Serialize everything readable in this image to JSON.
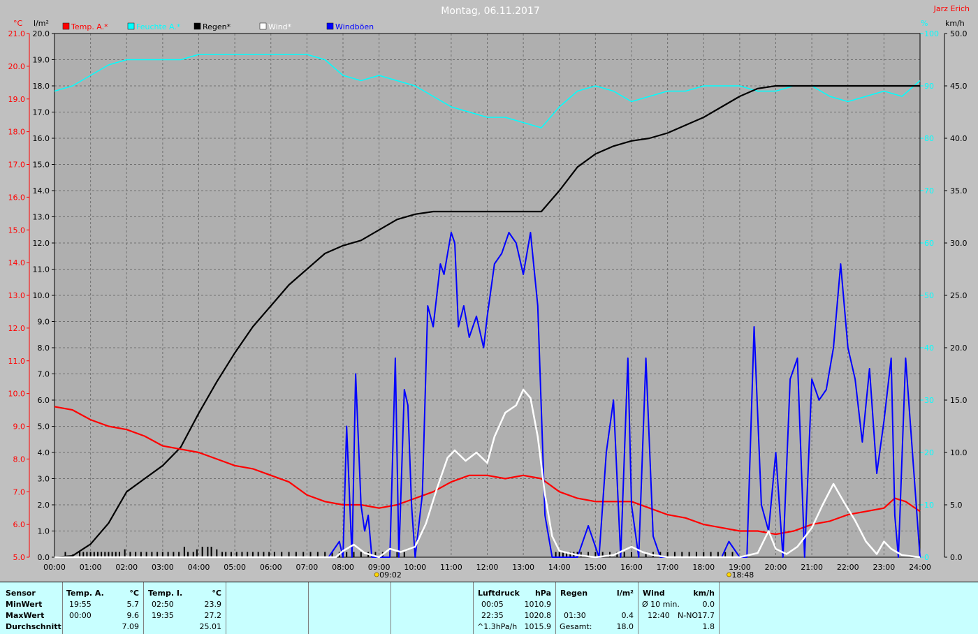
{
  "header": {
    "title": "Montag, 06.11.2017",
    "author": "Jarz Erich",
    "unit_temp": "°C",
    "unit_rain": "l/m²",
    "unit_hum": "%",
    "unit_wind": "km/h"
  },
  "legend": [
    {
      "label": "Temp. A.*",
      "color": "#ff0000"
    },
    {
      "label": "Feuchte A.*",
      "color": "#00ffff"
    },
    {
      "label": "Regen*",
      "color": "#000000"
    },
    {
      "label": "Wind*",
      "color": "#ffffff"
    },
    {
      "label": "Windböen",
      "color": "#0000ff"
    }
  ],
  "markers": [
    {
      "label": "09:02",
      "hour": 9.03
    },
    {
      "label": "18:48",
      "hour": 18.8
    }
  ],
  "chart_data": {
    "type": "line",
    "x_unit": "hour",
    "xlim": [
      0,
      24
    ],
    "x_tick_labels": [
      "00:00",
      "01:00",
      "02:00",
      "03:00",
      "04:00",
      "05:00",
      "06:00",
      "07:00",
      "08:00",
      "09:00",
      "10:00",
      "11:00",
      "12:00",
      "13:00",
      "14:00",
      "15:00",
      "16:00",
      "17:00",
      "18:00",
      "19:00",
      "20:00",
      "21:00",
      "22:00",
      "23:00",
      "24:00"
    ],
    "axes": {
      "temp": {
        "lim": [
          5,
          21
        ],
        "ticks": [
          "5.0",
          "6.0",
          "7.0",
          "8.0",
          "9.0",
          "10.0",
          "11.0",
          "12.0",
          "13.0",
          "14.0",
          "15.0",
          "16.0",
          "17.0",
          "18.0",
          "19.0",
          "20.0",
          "21.0"
        ],
        "color": "#ff0000"
      },
      "rain": {
        "lim": [
          0,
          20
        ],
        "ticks": [
          "0.0",
          "1.0",
          "2.0",
          "3.0",
          "4.0",
          "5.0",
          "6.0",
          "7.0",
          "8.0",
          "9.0",
          "10.0",
          "11.0",
          "12.0",
          "13.0",
          "14.0",
          "15.0",
          "16.0",
          "17.0",
          "18.0",
          "19.0",
          "20.0"
        ],
        "color": "#000000"
      },
      "hum": {
        "lim": [
          0,
          100
        ],
        "ticks": [
          "0",
          "10",
          "20",
          "30",
          "40",
          "50",
          "60",
          "70",
          "80",
          "90",
          "100"
        ],
        "color": "#00ffff"
      },
      "wind": {
        "lim": [
          0,
          50
        ],
        "ticks": [
          "0.0",
          "5.0",
          "10.0",
          "15.0",
          "20.0",
          "25.0",
          "30.0",
          "35.0",
          "40.0",
          "45.0",
          "50.0"
        ],
        "color": "#000000"
      }
    },
    "series": [
      {
        "name": "Temp. A.*",
        "axis": "temp",
        "color": "#ff0000",
        "width": 2.2,
        "x": [
          0,
          0.5,
          1,
          1.5,
          2,
          2.5,
          3,
          3.5,
          4,
          4.5,
          5,
          5.5,
          6,
          6.5,
          7,
          7.5,
          8,
          8.5,
          9,
          9.5,
          10,
          10.5,
          11,
          11.5,
          12,
          12.5,
          13,
          13.5,
          14,
          14.5,
          15,
          15.5,
          16,
          16.5,
          17,
          17.5,
          18,
          18.5,
          19,
          19.5,
          20,
          20.5,
          21,
          21.5,
          22,
          22.5,
          23,
          23.3,
          23.6,
          24
        ],
        "y": [
          9.6,
          9.5,
          9.2,
          9.0,
          8.9,
          8.7,
          8.4,
          8.3,
          8.2,
          8.0,
          7.8,
          7.7,
          7.5,
          7.3,
          6.9,
          6.7,
          6.6,
          6.6,
          6.5,
          6.6,
          6.8,
          7.0,
          7.3,
          7.5,
          7.5,
          7.4,
          7.5,
          7.4,
          7.0,
          6.8,
          6.7,
          6.7,
          6.7,
          6.5,
          6.3,
          6.2,
          6.0,
          5.9,
          5.8,
          5.8,
          5.7,
          5.8,
          6.0,
          6.1,
          6.3,
          6.4,
          6.5,
          6.8,
          6.7,
          6.4
        ]
      },
      {
        "name": "Feuchte A.*",
        "axis": "hum",
        "color": "#00ffff",
        "width": 1.5,
        "x": [
          0,
          0.5,
          1,
          1.5,
          2,
          2.5,
          3,
          3.5,
          4,
          5,
          6,
          7,
          7.5,
          8,
          8.5,
          9,
          9.5,
          10,
          10.5,
          11,
          11.5,
          12,
          12.5,
          13,
          13.5,
          14,
          14.5,
          15,
          15.5,
          16,
          16.5,
          17,
          17.5,
          18,
          18.5,
          19,
          19.5,
          20,
          20.5,
          21,
          21.5,
          22,
          22.5,
          23,
          23.5,
          24
        ],
        "y": [
          89,
          90,
          92,
          94,
          95,
          95,
          95,
          95,
          96,
          96,
          96,
          96,
          95,
          92,
          91,
          92,
          91,
          90,
          88,
          86,
          85,
          84,
          84,
          83,
          82,
          86,
          89,
          90,
          89,
          87,
          88,
          89,
          89,
          90,
          90,
          90,
          89,
          89,
          90,
          90,
          88,
          87,
          88,
          89,
          88,
          91
        ]
      },
      {
        "name": "Regen*",
        "axis": "rain",
        "color": "#000000",
        "width": 2.2,
        "x": [
          0,
          0.5,
          1,
          1.5,
          2,
          2.5,
          3,
          3.5,
          4,
          4.5,
          5,
          5.5,
          6,
          6.5,
          7,
          7.5,
          8,
          8.5,
          9,
          9.5,
          10,
          10.5,
          11,
          12,
          13,
          13.5,
          14,
          14.5,
          15,
          15.5,
          16,
          16.5,
          17,
          17.5,
          18,
          18.5,
          19,
          19.5,
          20,
          20.5,
          21,
          22,
          23,
          24
        ],
        "y": [
          0,
          0.05,
          0.5,
          1.3,
          2.5,
          3.0,
          3.5,
          4.2,
          5.5,
          6.7,
          7.8,
          8.8,
          9.6,
          10.4,
          11.0,
          11.6,
          11.9,
          12.1,
          12.5,
          12.9,
          13.1,
          13.2,
          13.2,
          13.2,
          13.2,
          13.2,
          14.0,
          14.9,
          15.4,
          15.7,
          15.9,
          16.0,
          16.2,
          16.5,
          16.8,
          17.2,
          17.6,
          17.9,
          18.0,
          18.0,
          18.0,
          18.0,
          18.0,
          18.0
        ]
      },
      {
        "name": "Wind*",
        "axis": "wind",
        "color": "#ffffff",
        "width": 2.5,
        "x": [
          0,
          7.8,
          8,
          8.3,
          8.6,
          9,
          9.3,
          9.6,
          10,
          10.3,
          10.6,
          10.9,
          11.1,
          11.4,
          11.7,
          12,
          12.2,
          12.5,
          12.8,
          13,
          13.2,
          13.4,
          13.6,
          13.8,
          14,
          14.5,
          15,
          15.5,
          16,
          16.3,
          16.6,
          17,
          18,
          19,
          19.5,
          19.8,
          20,
          20.3,
          20.6,
          21,
          21.3,
          21.6,
          21.9,
          22.2,
          22.5,
          22.8,
          23,
          23.2,
          23.5,
          24
        ],
        "y": [
          0,
          0,
          0.6,
          1.2,
          0.4,
          0,
          0.8,
          0.5,
          1.0,
          3.2,
          6.5,
          9.5,
          10.2,
          9.2,
          10.0,
          9.0,
          11.5,
          13.8,
          14.5,
          16.0,
          15.2,
          11.5,
          6.0,
          2.0,
          0.6,
          0.2,
          0,
          0.2,
          1.0,
          0.5,
          0.2,
          0,
          0,
          0,
          0.4,
          2.5,
          0.8,
          0.3,
          1.0,
          2.8,
          5.0,
          7.0,
          5.2,
          3.5,
          1.5,
          0.3,
          1.5,
          0.8,
          0.2,
          0
        ]
      },
      {
        "name": "Windböen",
        "axis": "wind",
        "color": "#0000ff",
        "width": 2.0,
        "x": [
          0,
          7.6,
          7.9,
          8.0,
          8.1,
          8.25,
          8.35,
          8.5,
          8.6,
          8.7,
          8.8,
          9.0,
          9.3,
          9.45,
          9.55,
          9.7,
          9.8,
          9.9,
          10.0,
          10.2,
          10.35,
          10.5,
          10.7,
          10.8,
          11.0,
          11.1,
          11.2,
          11.35,
          11.5,
          11.7,
          11.9,
          12.0,
          12.2,
          12.4,
          12.6,
          12.8,
          13.0,
          13.2,
          13.4,
          13.6,
          13.8,
          14.0,
          14.2,
          14.5,
          14.8,
          15.1,
          15.3,
          15.5,
          15.7,
          15.9,
          16.0,
          16.2,
          16.4,
          16.6,
          16.8,
          17.0,
          18.5,
          18.7,
          19.0,
          19.2,
          19.4,
          19.6,
          19.8,
          20.0,
          20.2,
          20.4,
          20.6,
          20.8,
          21.0,
          21.2,
          21.4,
          21.6,
          21.8,
          22.0,
          22.2,
          22.4,
          22.6,
          22.8,
          23.0,
          23.2,
          23.3,
          23.4,
          23.6,
          24
        ],
        "y": [
          0,
          0,
          1.5,
          0,
          12.5,
          0,
          17.5,
          5,
          2.5,
          4,
          0,
          0,
          0,
          19,
          0,
          16,
          14.5,
          5,
          0,
          6,
          24,
          22,
          28,
          27,
          31,
          30,
          22,
          24,
          21,
          23,
          20,
          23,
          28,
          29,
          31,
          30,
          27,
          31,
          24,
          4,
          0,
          0,
          0,
          0,
          3,
          0,
          10,
          15,
          0,
          19,
          5,
          0,
          19,
          2,
          0,
          0,
          0,
          1.5,
          0,
          0,
          22,
          5,
          2.5,
          10,
          0,
          17,
          19,
          0,
          17,
          15,
          16,
          20,
          28,
          20,
          17,
          11,
          18,
          8,
          13,
          19,
          4,
          0,
          19,
          0
        ]
      }
    ],
    "rain_bars": {
      "axis": "rain",
      "color": "#000000",
      "x": [
        0.3,
        0.5,
        0.7,
        0.8,
        0.9,
        1.0,
        1.1,
        1.2,
        1.3,
        1.4,
        1.5,
        1.6,
        1.7,
        1.8,
        1.95,
        2.1,
        2.25,
        2.4,
        2.55,
        2.7,
        2.85,
        3.0,
        3.15,
        3.3,
        3.45,
        3.6,
        3.7,
        3.85,
        3.95,
        4.1,
        4.25,
        4.35,
        4.5,
        4.65,
        4.75,
        4.9,
        5.05,
        5.2,
        5.35,
        5.5,
        5.65,
        5.8,
        5.95,
        6.1,
        6.3,
        6.5,
        6.7,
        6.9,
        7.1,
        7.3,
        7.5,
        7.7,
        7.9,
        8.1,
        8.3,
        8.5,
        8.7,
        8.9,
        9.1,
        9.3,
        9.5,
        9.7,
        13.9,
        14.0,
        14.1,
        14.2,
        14.3,
        14.4,
        14.5,
        14.6,
        14.8,
        15.0,
        15.2,
        15.4,
        15.6,
        15.8,
        16.0,
        16.2,
        16.4,
        16.6,
        16.8,
        17.0,
        17.2,
        17.4,
        17.6,
        17.8,
        18.0,
        18.2,
        18.4,
        18.6,
        18.8
      ],
      "values": [
        0.2,
        0.1,
        0.2,
        0.2,
        0.2,
        0.2,
        0.2,
        0.2,
        0.2,
        0.2,
        0.2,
        0.2,
        0.2,
        0.2,
        0.3,
        0.2,
        0.2,
        0.2,
        0.2,
        0.2,
        0.2,
        0.2,
        0.2,
        0.2,
        0.2,
        0.4,
        0.2,
        0.2,
        0.3,
        0.4,
        0.4,
        0.4,
        0.3,
        0.2,
        0.2,
        0.2,
        0.2,
        0.2,
        0.2,
        0.2,
        0.2,
        0.2,
        0.2,
        0.2,
        0.2,
        0.2,
        0.2,
        0.2,
        0.2,
        0.2,
        0.2,
        0.2,
        0.2,
        0.2,
        0.2,
        0.2,
        0.2,
        0.2,
        0.2,
        0.2,
        0.2,
        0.2,
        0.2,
        0.2,
        0.2,
        0.2,
        0.2,
        0.2,
        0.2,
        0.2,
        0.2,
        0.2,
        0.2,
        0.2,
        0.2,
        0.2,
        0.2,
        0.2,
        0.2,
        0.2,
        0.2,
        0.2,
        0.2,
        0.2,
        0.2,
        0.2,
        0.2,
        0.2,
        0.2,
        0.2,
        0.2
      ]
    }
  },
  "stats": {
    "col_sensor": {
      "header": "Sensor",
      "rows": [
        "MinWert",
        "MaxWert",
        "Durchschnitt"
      ]
    },
    "temp_a": {
      "header": "Temp. A.",
      "unit": "°C",
      "times": [
        "19:55",
        "00:00",
        ""
      ],
      "values": [
        "5.7",
        "9.6",
        "7.09"
      ]
    },
    "temp_i": {
      "header": "Temp. I.",
      "unit": "°C",
      "times": [
        "02:50",
        "19:35",
        ""
      ],
      "values": [
        "23.9",
        "27.2",
        "25.01"
      ]
    },
    "pressure": {
      "header": "Luftdruck",
      "unit": "hPa",
      "times": [
        "00:05",
        "22:35",
        "^1.3hPa/h"
      ],
      "values": [
        "1010.9",
        "1020.8",
        "1015.9"
      ]
    },
    "rain": {
      "header": "Regen",
      "unit": "l/m²",
      "times": [
        "",
        "01:30",
        "Gesamt:"
      ],
      "values": [
        "",
        "0.4",
        "18.0"
      ]
    },
    "wind": {
      "header": "Wind",
      "unit": "km/h",
      "times": [
        "Ø 10 min.",
        "12:40",
        ""
      ],
      "dirs": [
        "",
        "N-NO",
        ""
      ],
      "values": [
        "0.0",
        "17.7",
        "1.8"
      ]
    }
  }
}
